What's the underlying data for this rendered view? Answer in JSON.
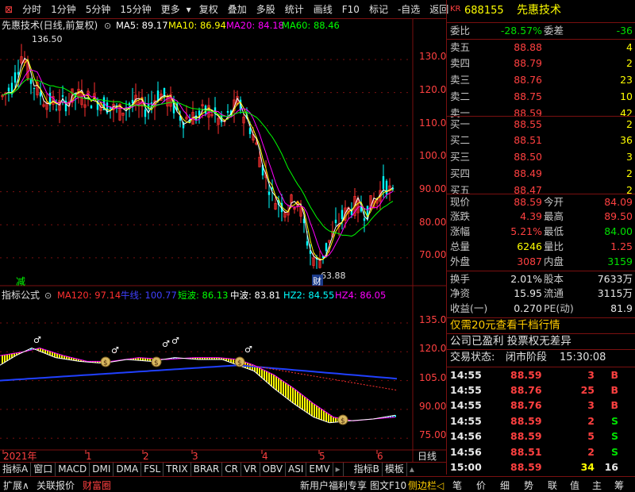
{
  "toolbar": {
    "items": [
      "分时",
      "1分钟",
      "5分钟",
      "15分钟",
      "更多",
      "复权",
      "叠加",
      "多股",
      "统计",
      "画线",
      "F10",
      "标记",
      "-自选",
      "返回"
    ]
  },
  "main_chart": {
    "title": "先惠技术(日线,前复权)",
    "ma": [
      {
        "label": "MA5: 89.17",
        "color": "#ffffff"
      },
      {
        "label": "MA10: 86.94",
        "color": "#ffff00"
      },
      {
        "label": "MA20: 84.18",
        "color": "#ff00ff"
      },
      {
        "label": "MA60: 88.46",
        "color": "#00ff00"
      }
    ],
    "y_ticks": [
      "130.0",
      "120.0",
      "110.0",
      "100.0",
      "90.00",
      "80.00",
      "70.00"
    ],
    "high_label": "136.50",
    "low_label": "63.88",
    "reduce_label": "减",
    "cai_label": "财"
  },
  "indicator": {
    "name": "指标公式",
    "lines": [
      {
        "label": "MA120: 97.14",
        "color": "#ff3030"
      },
      {
        "label": "牛线: 100.77",
        "color": "#4040ff"
      },
      {
        "label": "短波: 86.13",
        "color": "#00ff00"
      },
      {
        "label": "中波: 83.81",
        "color": "#ffffff"
      },
      {
        "label": "HZ2: 84.55",
        "color": "#00ffff"
      },
      {
        "label": "HZ4: 86.05",
        "color": "#ff00ff"
      }
    ],
    "y_ticks": [
      "135.0",
      "120.0",
      "105.0",
      "90.00",
      "75.00"
    ]
  },
  "x_axis": {
    "labels": [
      "2021年",
      "1",
      "2",
      "3",
      "4",
      "5",
      "6"
    ],
    "period": "日线"
  },
  "tabs": [
    "指标A",
    "窗口",
    "MACD",
    "DMI",
    "DMA",
    "FSL",
    "TRIX",
    "BRAR",
    "CR",
    "VR",
    "OBV",
    "ASI",
    "EMV",
    "指标B",
    "模板"
  ],
  "footer": {
    "left": [
      "扩展∧",
      "关联报价",
      "财富圈"
    ],
    "mid": [
      "新用户福利专享",
      "图文F10",
      "侧边栏◁"
    ],
    "right_tabs": [
      "笔",
      "价",
      "细",
      "势",
      "联",
      "值",
      "主",
      "筹"
    ]
  },
  "quote": {
    "badge": "KR",
    "code": "688155",
    "name": "先惠技术",
    "weibi_label": "委比",
    "weibi": "-28.57%",
    "weicha_label": "委差",
    "weicha": "-36",
    "sell": [
      {
        "label": "卖五",
        "price": "88.88",
        "vol": "4"
      },
      {
        "label": "卖四",
        "price": "88.79",
        "vol": "2"
      },
      {
        "label": "卖三",
        "price": "88.76",
        "vol": "23"
      },
      {
        "label": "卖二",
        "price": "88.75",
        "vol": "10"
      },
      {
        "label": "卖一",
        "price": "88.59",
        "vol": "42"
      }
    ],
    "buy": [
      {
        "label": "买一",
        "price": "88.55",
        "vol": "2"
      },
      {
        "label": "买二",
        "price": "88.51",
        "vol": "36"
      },
      {
        "label": "买三",
        "price": "88.50",
        "vol": "3"
      },
      {
        "label": "买四",
        "price": "88.49",
        "vol": "2"
      },
      {
        "label": "买五",
        "price": "88.47",
        "vol": "2"
      }
    ],
    "stats": [
      {
        "l1": "现价",
        "v1": "88.59",
        "l2": "今开",
        "v2": "84.09"
      },
      {
        "l1": "涨跌",
        "v1": "4.39",
        "l2": "最高",
        "v2": "89.50"
      },
      {
        "l1": "涨幅",
        "v1": "5.21%",
        "l2": "最低",
        "v2": "84.00"
      },
      {
        "l1": "总量",
        "v1": "6246",
        "l2": "量比",
        "v2": "1.25"
      },
      {
        "l1": "外盘",
        "v1": "3087",
        "l2": "内盘",
        "v2": "3159"
      }
    ],
    "stats2": [
      {
        "l1": "换手",
        "v1": "2.01%",
        "l2": "股本",
        "v2": "7633万"
      },
      {
        "l1": "净资",
        "v1": "15.95",
        "l2": "流通",
        "v2": "3115万"
      },
      {
        "l1": "收益(一)",
        "v1": "0.270",
        "l2": "PE(动)",
        "v2": "81.9"
      }
    ],
    "promo": "仅需20元查看千档行情",
    "company": "公司已盈利 投票权无差异",
    "status_label": "交易状态:",
    "status": "闭市阶段",
    "status_time": "15:30:08",
    "ticks": [
      {
        "t": "14:55",
        "p": "88.59",
        "v": "3",
        "d": "B"
      },
      {
        "t": "14:55",
        "p": "88.76",
        "v": "25",
        "d": "B"
      },
      {
        "t": "14:55",
        "p": "88.76",
        "v": "3",
        "d": "B"
      },
      {
        "t": "14:55",
        "p": "88.59",
        "v": "2",
        "d": "S"
      },
      {
        "t": "14:56",
        "p": "88.59",
        "v": "5",
        "d": "S"
      },
      {
        "t": "14:56",
        "p": "88.51",
        "v": "2",
        "d": "S"
      },
      {
        "t": "15:00",
        "p": "88.59",
        "v": "34",
        "d": "16"
      }
    ]
  }
}
